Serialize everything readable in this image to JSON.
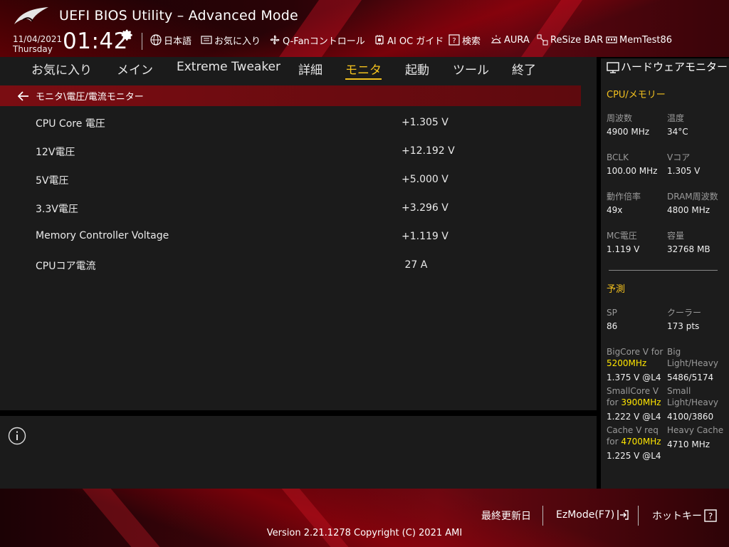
{
  "header": {
    "title": "UEFI BIOS Utility – Advanced Mode",
    "date": "11/04/2021",
    "weekday": "Thursday",
    "time": "01:42",
    "toolbar": [
      {
        "label": "日本語",
        "icon": "globe-icon"
      },
      {
        "label": "お気に入り",
        "icon": "favorites-icon"
      },
      {
        "label": "Q-Fanコントロール",
        "icon": "fan-icon"
      },
      {
        "label": "AI OC ガイド",
        "icon": "ai-oc-icon"
      },
      {
        "label": "検索",
        "icon": "search-help-icon"
      },
      {
        "label": "AURA",
        "icon": "aura-icon"
      },
      {
        "label": "ReSize BAR",
        "icon": "resize-bar-icon"
      },
      {
        "label": "MemTest86",
        "icon": "memtest-icon"
      }
    ]
  },
  "menu": {
    "items": [
      "お気に入り",
      "メイン",
      "Extreme Tweaker",
      "詳細",
      "モニタ",
      "起動",
      "ツール",
      "終了"
    ],
    "active": "モニタ"
  },
  "breadcrumb": "モニタ\\電圧/電流モニター",
  "rows": [
    {
      "label": "CPU Core 電圧",
      "value": "+1.305 V"
    },
    {
      "label": "12V電圧",
      "value": "+12.192 V"
    },
    {
      "label": "5V電圧",
      "value": "+5.000 V"
    },
    {
      "label": "3.3V電圧",
      "value": "+3.296 V"
    },
    {
      "label": "Memory Controller Voltage",
      "value": "+1.119 V"
    },
    {
      "label": "CPUコア電流",
      "value": " 27 A"
    }
  ],
  "hw_monitor": {
    "title": "ハードウェアモニター",
    "cpu_mem_section": "CPU/メモリー",
    "freq_label": "周波数",
    "freq_value": "4900 MHz",
    "temp_label": "温度",
    "temp_value": "34°C",
    "bclk_label": "BCLK",
    "bclk_value": "100.00 MHz",
    "vcore_label": "Vコア",
    "vcore_value": "1.305 V",
    "ratio_label": "動作倍率",
    "ratio_value": "49x",
    "dram_label": "DRAM周波数",
    "dram_value": "4800 MHz",
    "mc_label": "MC電圧",
    "mc_value": "1.119 V",
    "cap_label": "容量",
    "cap_value": "32768 MB",
    "predict_section": "予測",
    "sp_label": "SP",
    "sp_value": "86",
    "cooler_label": "クーラー",
    "cooler_value": "173 pts",
    "bigcore_label": "BigCore V for",
    "bigcore_freq": "5200MHz",
    "bigcore_value": "1.375 V @L4",
    "big_label_1": "Big",
    "big_label_2": "Light/Heavy",
    "big_value": "5486/5174",
    "smallcore_label": "SmallCore V",
    "smallcore_for": "for",
    "smallcore_freq": "3900MHz",
    "smallcore_value": "1.222 V @L4",
    "small_label_1": "Small",
    "small_label_2": "Light/Heavy",
    "small_value": "4100/3860",
    "cache_label": "Cache V req",
    "cache_for": "for",
    "cache_freq": "4700MHz",
    "cache_value": "1.225 V @L4",
    "heavycache_label": "Heavy Cache",
    "heavycache_value": "4710 MHz"
  },
  "footer": {
    "last_modified": "最終更新日",
    "ezmode": "EzMode(F7)",
    "hotkeys": "ホットキー",
    "version": "Version 2.21.1278 Copyright (C) 2021 AMI"
  },
  "colors": {
    "accent": "#f2c01e",
    "highlight": "#ffe600",
    "breadcrumb_bg": "#7a0d12",
    "panel_bg": "#1b1b1b"
  }
}
